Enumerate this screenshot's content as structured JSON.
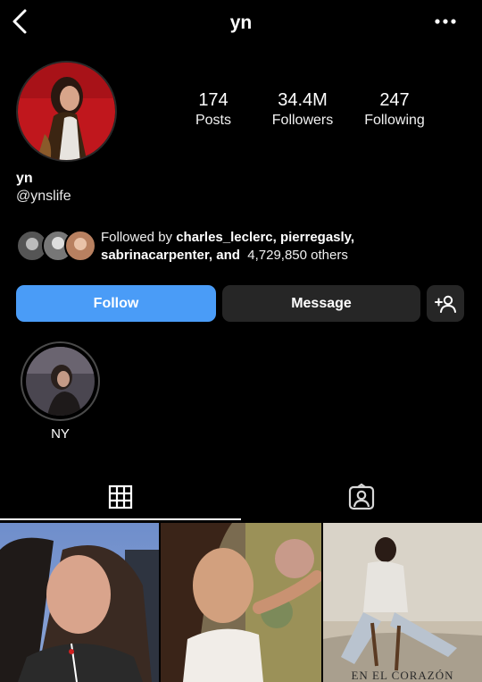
{
  "header": {
    "title": "yn",
    "back_icon": "chevron-left-icon",
    "more_icon": "ellipsis-horizontal-icon"
  },
  "profile": {
    "name": "yn",
    "handle": "@ynslife",
    "stats": [
      {
        "value": "174",
        "label": "Posts"
      },
      {
        "value": "34.4M",
        "label": "Followers"
      },
      {
        "value": "247",
        "label": "Following"
      }
    ]
  },
  "followed_by": {
    "prefix": "Followed by ",
    "names": "charles_leclerc, pierregasly,",
    "names_line2": "sabrinacarpenter, and",
    "others": "4,729,850 others"
  },
  "actions": {
    "follow_label": "Follow",
    "message_label": "Message",
    "add_icon": "add-person-icon"
  },
  "highlights": [
    {
      "label": "NY"
    }
  ],
  "tabs": [
    {
      "icon": "grid-icon",
      "active": true
    },
    {
      "icon": "tagged-person-icon",
      "active": false
    }
  ],
  "posts": [
    {
      "caption": ""
    },
    {
      "caption": ""
    },
    {
      "caption": "EN EL CORAZÓN"
    }
  ],
  "colors": {
    "background": "#000000",
    "follow_blue": "#4a9cf7",
    "secondary_button": "#262626"
  }
}
